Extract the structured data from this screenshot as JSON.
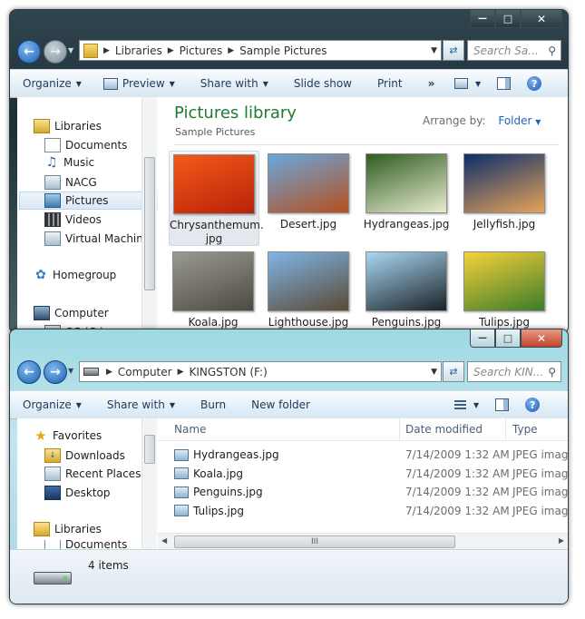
{
  "top_window": {
    "caption": {
      "minimize": "—",
      "maximize": "□",
      "close": "✕"
    },
    "address": {
      "segments": [
        "Libraries",
        "Pictures",
        "Sample Pictures"
      ]
    },
    "search_placeholder": "Search Sa...",
    "toolbar": {
      "organize": "Organize",
      "preview": "Preview",
      "share_with": "Share with",
      "slide_show": "Slide show",
      "print": "Print",
      "more": "»"
    },
    "tree": {
      "items": [
        {
          "label": "Libraries",
          "icon": "libraries-icon"
        },
        {
          "label": "Documents",
          "icon": "documents-icon"
        },
        {
          "label": "Music",
          "icon": "music-icon"
        },
        {
          "label": "NACG",
          "icon": "folder-icon"
        },
        {
          "label": "Pictures",
          "icon": "pictures-icon"
        },
        {
          "label": "Videos",
          "icon": "videos-icon"
        },
        {
          "label": "Virtual Machines",
          "icon": "folder-icon"
        },
        {
          "label": "Homegroup",
          "icon": "homegroup-icon"
        },
        {
          "label": "Computer",
          "icon": "computer-icon"
        },
        {
          "label": "OS (C:)",
          "icon": "drive-icon"
        }
      ]
    },
    "library_title": "Pictures library",
    "library_subtitle": "Sample Pictures",
    "arrange_by_label": "Arrange by:",
    "arrange_by_value": "Folder",
    "thumbnails": [
      {
        "label": "Chrysanthemum.\njpg",
        "colors": [
          "#f25a1a",
          "#b92208"
        ]
      },
      {
        "label": "Desert.jpg",
        "colors": [
          "#6aa7dc",
          "#b4501f"
        ]
      },
      {
        "label": "Hydrangeas.jpg",
        "colors": [
          "#2f5c21",
          "#e8ecd0"
        ]
      },
      {
        "label": "Jellyfish.jpg",
        "colors": [
          "#0b2f6a",
          "#e8a25a"
        ]
      },
      {
        "label": "Koala.jpg",
        "colors": [
          "#9a9a92",
          "#4e4a40"
        ]
      },
      {
        "label": "Lighthouse.jpg",
        "colors": [
          "#7fb5e6",
          "#5a4a36"
        ]
      },
      {
        "label": "Penguins.jpg",
        "colors": [
          "#a9d7f3",
          "#1b2228"
        ]
      },
      {
        "label": "Tulips.jpg",
        "colors": [
          "#f7d13a",
          "#3b7c2a"
        ]
      }
    ]
  },
  "bottom_window": {
    "caption": {
      "minimize": "—",
      "maximize": "□",
      "close": "✕"
    },
    "address": {
      "segments": [
        "Computer",
        "KINGSTON (F:)"
      ]
    },
    "search_placeholder": "Search KIN...",
    "toolbar": {
      "organize": "Organize",
      "share_with": "Share with",
      "burn": "Burn",
      "new_folder": "New folder"
    },
    "tree": {
      "items": [
        {
          "label": "Favorites",
          "icon": "favorites-star-icon"
        },
        {
          "label": "Downloads",
          "icon": "downloads-icon"
        },
        {
          "label": "Recent Places",
          "icon": "recent-places-icon"
        },
        {
          "label": "Desktop",
          "icon": "desktop-icon"
        },
        {
          "label": "Libraries",
          "icon": "libraries-icon"
        },
        {
          "label": "Documents",
          "icon": "documents-icon"
        }
      ]
    },
    "columns": {
      "name": "Name",
      "date_modified": "Date modified",
      "type": "Type"
    },
    "files": [
      {
        "name": "Hydrangeas.jpg",
        "date": "7/14/2009 1:32 AM",
        "type": "JPEG imag"
      },
      {
        "name": "Koala.jpg",
        "date": "7/14/2009 1:32 AM",
        "type": "JPEG imag"
      },
      {
        "name": "Penguins.jpg",
        "date": "7/14/2009 1:32 AM",
        "type": "JPEG imag"
      },
      {
        "name": "Tulips.jpg",
        "date": "7/14/2009 1:32 AM",
        "type": "JPEG imag"
      }
    ],
    "hscroll_grip": "III",
    "status": {
      "count": "4 items"
    }
  }
}
